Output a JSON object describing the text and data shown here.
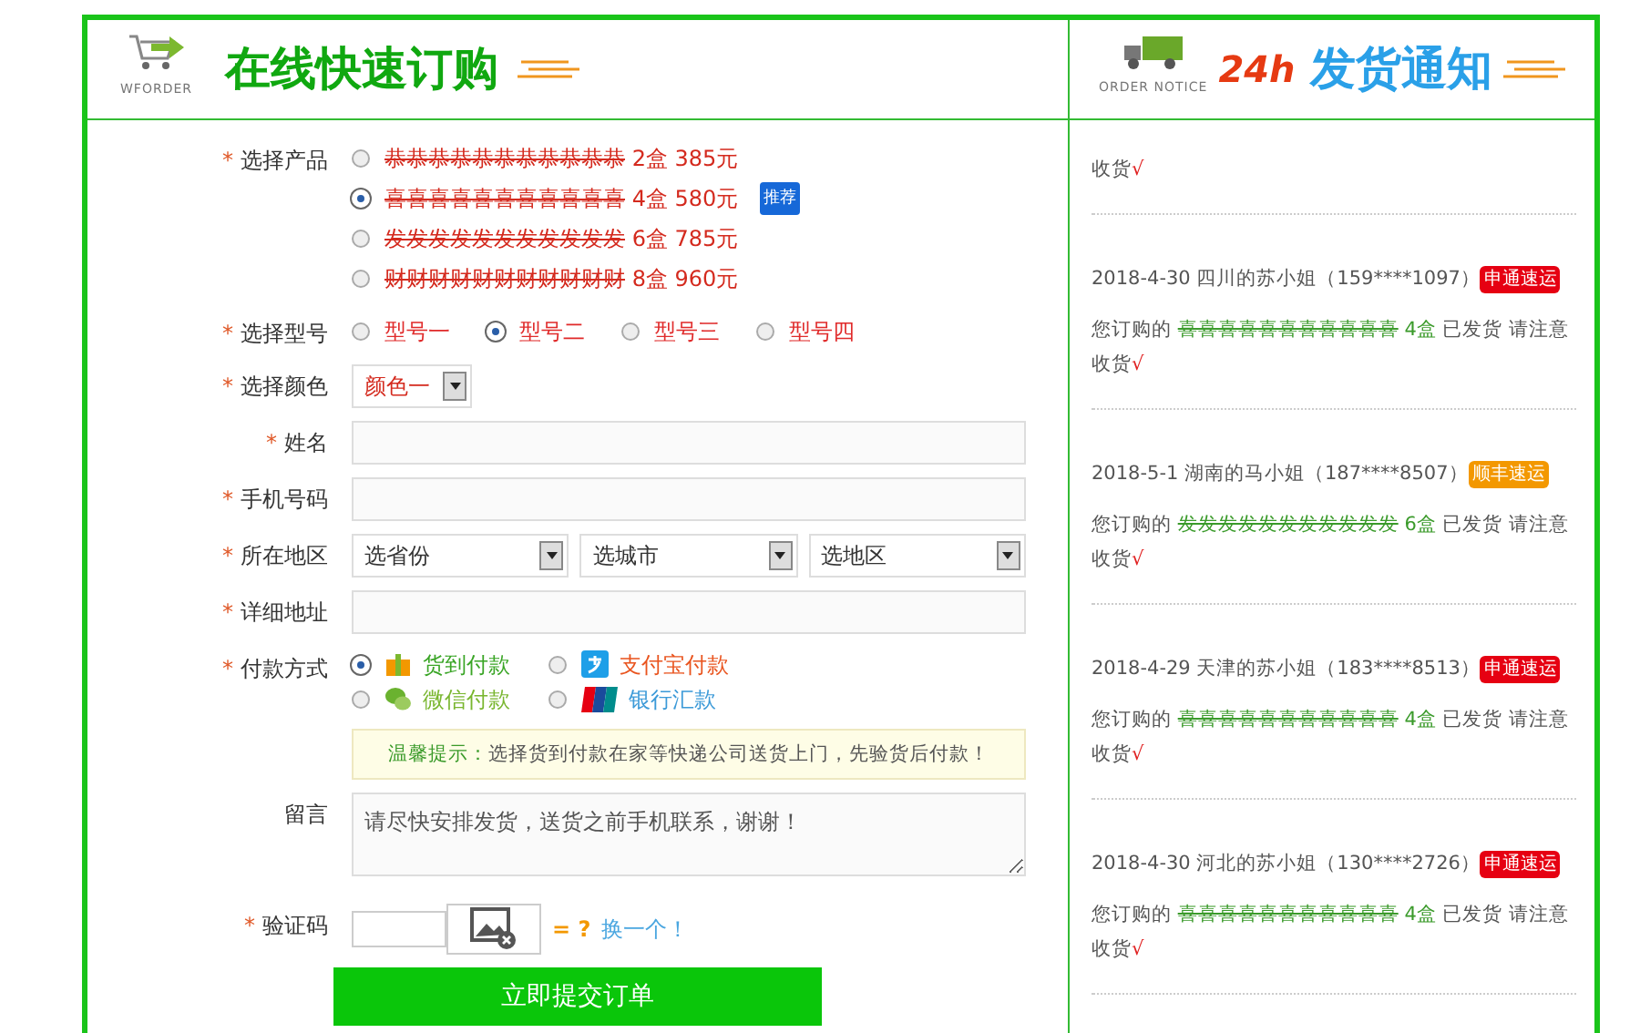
{
  "order_panel": {
    "header": {
      "logo_caption": "WFORDER",
      "title": "在线快速订购"
    },
    "product": {
      "label": "选择产品",
      "required_mark": "*",
      "options": [
        {
          "name": "恭恭恭恭恭恭恭恭恭恭恭",
          "detail": "2盒 385元",
          "selected": false
        },
        {
          "name": "喜喜喜喜喜喜喜喜喜喜喜",
          "detail": "4盒 580元",
          "selected": true,
          "badge": "推荐"
        },
        {
          "name": "发发发发发发发发发发发",
          "detail": "6盒 785元",
          "selected": false
        },
        {
          "name": "财财财财财财财财财财财",
          "detail": "8盒 960元",
          "selected": false
        }
      ]
    },
    "model": {
      "label": "选择型号",
      "required_mark": "*",
      "options": [
        {
          "label": "型号一",
          "selected": false
        },
        {
          "label": "型号二",
          "selected": true
        },
        {
          "label": "型号三",
          "selected": false
        },
        {
          "label": "型号四",
          "selected": false
        }
      ]
    },
    "color": {
      "label": "选择颜色",
      "required_mark": "*",
      "value": "颜色一"
    },
    "name": {
      "label": "姓名",
      "required_mark": "*"
    },
    "phone": {
      "label": "手机号码",
      "required_mark": "*"
    },
    "region": {
      "label": "所在地区",
      "required_mark": "*",
      "selects": [
        "选省份",
        "选城市",
        "选地区"
      ]
    },
    "address": {
      "label": "详细地址",
      "required_mark": "*"
    },
    "payment": {
      "label": "付款方式",
      "required_mark": "*",
      "options": [
        {
          "kind": "cod",
          "label": "货到付款",
          "selected": true
        },
        {
          "kind": "alipay",
          "label": "支付宝付款",
          "selected": false
        },
        {
          "kind": "wechat",
          "label": "微信付款",
          "selected": false
        },
        {
          "kind": "bank",
          "label": "银行汇款",
          "selected": false
        }
      ]
    },
    "tip": {
      "prefix": "温馨提示：",
      "text": "选择货到付款在家等快递公司送货上门，先验货后付款！"
    },
    "message": {
      "label": "留言",
      "value": "请尽快安排发货，送货之前手机联系，谢谢！"
    },
    "captcha": {
      "label": "验证码",
      "required_mark": "*",
      "equals": "= ?",
      "refresh_link": "换一个！"
    },
    "submit": "立即提交订单"
  },
  "notice_panel": {
    "header": {
      "caption": "ORDER NOTICE",
      "badge": "24h",
      "title": "发货通知"
    },
    "items": [
      {
        "message_tail": "收货",
        "mark": "√"
      },
      {
        "heading": "2018-4-30 四川的苏小姐（159****1097）",
        "courier": {
          "label": "申通速运",
          "color": "#e60012"
        },
        "message": {
          "prefix": "您订购的",
          "product": "喜喜喜喜喜喜喜喜喜喜喜",
          "quantity": "4盒",
          "status": "已发货 请注意收货",
          "mark": "√"
        }
      },
      {
        "heading": "2018-5-1 湖南的马小姐（187****8507）",
        "courier": {
          "label": "顺丰速运",
          "color": "#f39800"
        },
        "message": {
          "prefix": "您订购的",
          "product": "发发发发发发发发发发发",
          "quantity": "6盒",
          "status": "已发货 请注意收货",
          "mark": "√"
        }
      },
      {
        "heading": "2018-4-29 天津的苏小姐（183****8513）",
        "courier": {
          "label": "申通速运",
          "color": "#e60012"
        },
        "message": {
          "prefix": "您订购的",
          "product": "喜喜喜喜喜喜喜喜喜喜喜",
          "quantity": "4盒",
          "status": "已发货 请注意收货",
          "mark": "√"
        }
      },
      {
        "heading": "2018-4-30 河北的苏小姐（130****2726）",
        "courier": {
          "label": "申通速运",
          "color": "#e60012"
        },
        "message": {
          "prefix": "您订购的",
          "product": "喜喜喜喜喜喜喜喜喜喜喜",
          "quantity": "4盒",
          "status": "已发货 请注意收货",
          "mark": "√"
        }
      }
    ]
  }
}
